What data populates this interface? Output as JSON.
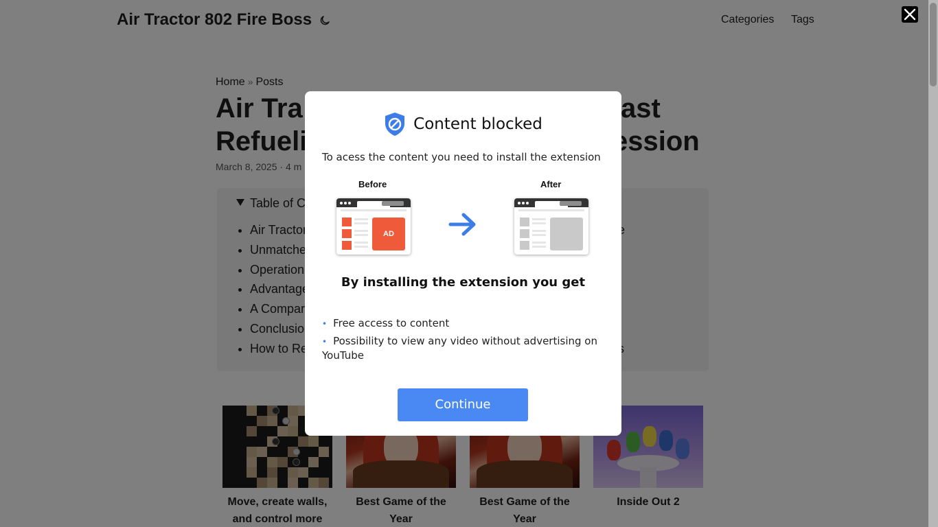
{
  "header": {
    "site_title": "Air Tractor 802 Fire Boss",
    "nav": [
      "Categories",
      "Tags"
    ]
  },
  "breadcrumb": [
    "Home",
    "Posts"
  ],
  "post": {
    "title_visible": "Air Tra… ast Refueli… ession",
    "title_left_line1": "Air Tra",
    "title_right_line1": "ast",
    "title_left_line2": "Refueli",
    "title_right_line2": "ession",
    "meta": "March 8, 2025 · 4 m"
  },
  "toc": {
    "summary": "Table of C",
    "items": [
      {
        "left": "Air Tractor",
        "right": "e"
      },
      {
        "left": "Unmatche",
        "right": ""
      },
      {
        "left": "Operation",
        "right": ""
      },
      {
        "left": "Advantage",
        "right": ""
      },
      {
        "left": "A Compar",
        "right": ""
      },
      {
        "left": "Conclusio",
        "right": ""
      },
      {
        "left": "How to Re",
        "right": "s"
      }
    ]
  },
  "related": [
    {
      "caption": "Move, create walls, and control more"
    },
    {
      "caption": "Best Game of the Year"
    },
    {
      "caption": "Best Game of the Year"
    },
    {
      "caption": "Inside Out 2"
    }
  ],
  "modal": {
    "title": "Content blocked",
    "description": "To acess the content you need to install the extension",
    "before_label": "Before",
    "after_label": "After",
    "ad_label": "AD",
    "benefits_title": "By installing the extension you get",
    "benefits": [
      "Free access to content",
      "Possibility to view any video without advertising on YouTube"
    ],
    "continue_label": "Continue"
  },
  "colors": {
    "accent": "#4a89f3",
    "ad_red": "#ef5a3a",
    "overlay": "rgba(0,0,0,0.5)"
  },
  "icons": [
    "moon-icon",
    "close-icon",
    "shield-block-icon",
    "arrow-right-icon"
  ]
}
